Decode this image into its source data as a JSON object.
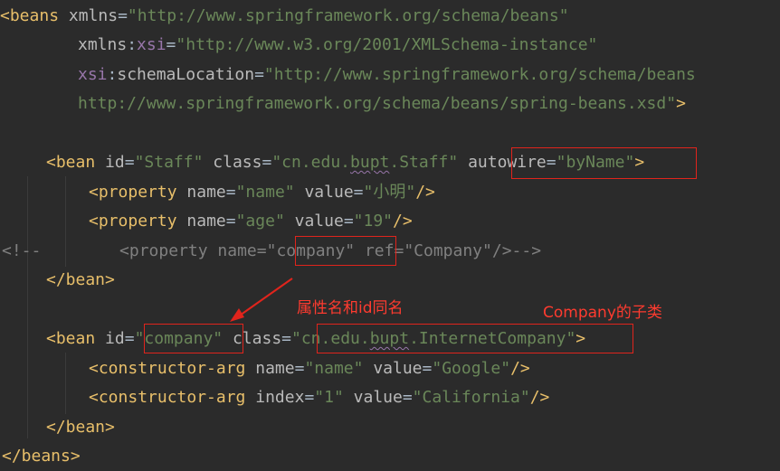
{
  "code": {
    "line1": {
      "open": "<",
      "tag": "beans",
      "attr": "xmlns",
      "eq": "=",
      "value": "\"http://www.springframework.org/schema/beans\""
    },
    "line2": {
      "attr": "xmlns",
      "colon": ":",
      "ns": "xsi",
      "eq": "=",
      "value": "\"http://www.w3.org/2001/XMLSchema-instance\""
    },
    "line3": {
      "ns": "xsi",
      "colon": ":",
      "attr": "schemaLocation",
      "eq": "=",
      "value": "\"http://www.springframework.org/schema/beans"
    },
    "line4": {
      "value": "http://www.springframework.org/schema/beans/spring-beans.xsd\"",
      "close": ">"
    },
    "line5": {
      "open": "<",
      "tag": "bean",
      "attr1": "id",
      "eq": "=",
      "value1": "\"Staff\"",
      "attr2": "class",
      "value2_pre": "\"cn.edu.",
      "value2_squig": "bupt",
      "value2_post": ".Staff\"",
      "attr3": "autowire",
      "value3": "\"byName\"",
      "close": ">"
    },
    "line6": {
      "open": "<",
      "tag": "property",
      "attr1": "name",
      "eq": "=",
      "value1": "\"name\"",
      "attr2": "value",
      "value2": "\"小明\"",
      "close": "/>"
    },
    "line7": {
      "open": "<",
      "tag": "property",
      "attr1": "name",
      "eq": "=",
      "value1": "\"age\"",
      "attr2": "value",
      "value2": "\"19\"",
      "close": "/>"
    },
    "line8": {
      "c1": "<!--        <property name=\"",
      "c2": "company",
      "c3": "\" ref=\"Company\"/>-->"
    },
    "line9": {
      "text": "</bean>"
    },
    "line10": {
      "open": "<",
      "tag": "bean",
      "attr1": "id",
      "eq": "=",
      "value1_q1": "\"",
      "value1": "company",
      "value1_q2": "\"",
      "attr2": "class",
      "value2_q1": "\"",
      "value2_pre": "cn.edu.",
      "value2_squig": "bupt",
      "value2_post": ".InternetCompany",
      "value2_q2": "\"",
      "close": ">"
    },
    "line11": {
      "open": "<",
      "tag": "constructor-arg",
      "attr1": "name",
      "eq": "=",
      "value1": "\"name\"",
      "attr2": "value",
      "value2": "\"Google\"",
      "close": "/>"
    },
    "line12": {
      "open": "<",
      "tag": "constructor-arg",
      "attr1": "index",
      "eq": "=",
      "value1": "\"1\"",
      "attr2": "value",
      "value2": "\"California\"",
      "close": "/>"
    },
    "line13": {
      "text": "</bean>"
    },
    "line14": {
      "text": "</beans>"
    }
  },
  "annotations": {
    "same_name_note": "属性名和id同名",
    "subclass_note": "Company的子类",
    "color": "#e0241c"
  }
}
